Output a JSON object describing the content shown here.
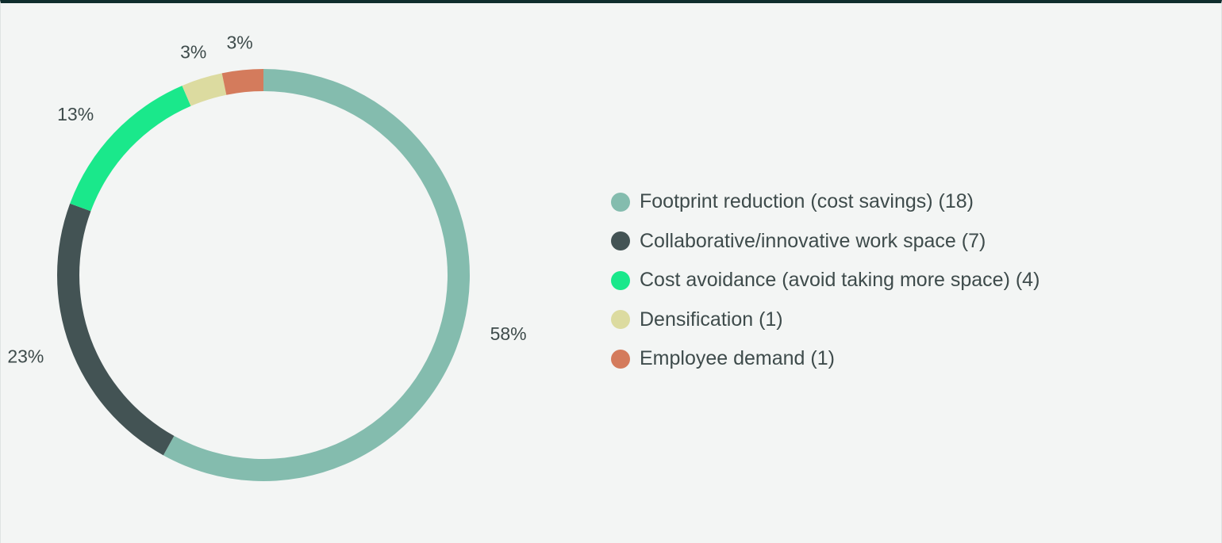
{
  "chart_data": {
    "type": "pie",
    "style": "donut",
    "start_angle": "top (12 o'clock)",
    "direction": "clockwise",
    "slices": [
      {
        "label": "Footprint reduction (cost savings) (18)",
        "count": 18,
        "percent_label": "58%",
        "color": "#84bcae"
      },
      {
        "label": "Collaborative/innovative work space (7)",
        "count": 7,
        "percent_label": "23%",
        "color": "#435354"
      },
      {
        "label": "Cost avoidance (avoid taking more space) (4)",
        "count": 4,
        "percent_label": "13%",
        "color": "#1ae88b"
      },
      {
        "label": "Densification (1)",
        "count": 1,
        "percent_label": "3%",
        "color": "#dcdba0"
      },
      {
        "label": "Employee demand (1)",
        "count": 1,
        "percent_label": "3%",
        "color": "#d47b5c"
      }
    ],
    "legend_position": "right"
  }
}
